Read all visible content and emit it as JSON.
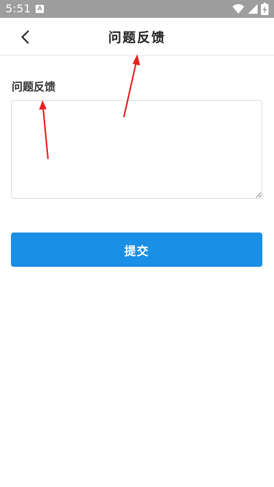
{
  "status_bar": {
    "time": "5:51",
    "notification_icon_label": "A",
    "icons": [
      "wifi-icon",
      "signal-icon",
      "battery-charging-icon"
    ],
    "background_color": "#9e9e9e"
  },
  "app_bar": {
    "title": "问题反馈",
    "back_icon": "chevron-left-icon"
  },
  "form": {
    "label": "问题反馈",
    "textarea_value": "",
    "textarea_placeholder": "",
    "submit_label": "提交",
    "submit_color": "#1a8fe6"
  },
  "annotations": {
    "arrow_color": "#e8201c"
  }
}
